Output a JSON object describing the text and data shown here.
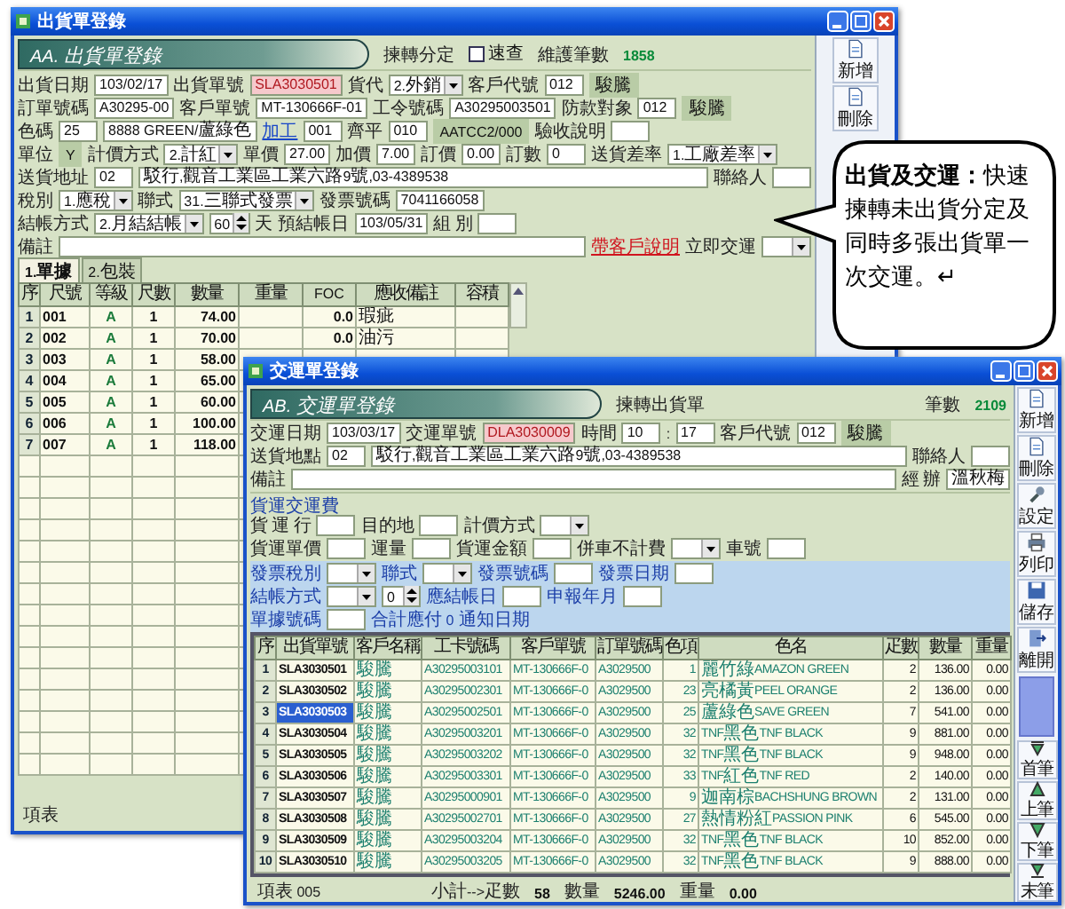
{
  "window_1": {
    "title": "出貨單登錄",
    "heading": "AA. 出貨單登錄",
    "header_text": "揀轉分定",
    "quick_check": {
      "label": "速查",
      "checked": false
    },
    "count_label": "維護筆數",
    "count": "1858",
    "toolbar": [
      {
        "label": "新增"
      },
      {
        "label": "刪除"
      }
    ],
    "form_rows": [
      [
        {
          "kind": "label",
          "text": "出貨日期"
        },
        {
          "kind": "field",
          "value": "103/02/17"
        },
        {
          "kind": "label",
          "text": "出貨單號"
        },
        {
          "kind": "key",
          "value": "SLA3030501"
        },
        {
          "kind": "label",
          "text": "貨代"
        },
        {
          "kind": "select",
          "value": "2.外銷"
        },
        {
          "kind": "label",
          "text": "客戶代號"
        },
        {
          "kind": "field",
          "value": "012"
        },
        {
          "kind": "shade",
          "text": "駿騰"
        }
      ],
      [
        {
          "kind": "label",
          "text": "訂單號碼"
        },
        {
          "kind": "field",
          "value": "A30295-00"
        },
        {
          "kind": "label",
          "text": "客戶單號"
        },
        {
          "kind": "field",
          "value": "MT-130666F-01"
        },
        {
          "kind": "label",
          "text": "工令號碼"
        },
        {
          "kind": "field",
          "value": "A30295003501"
        },
        {
          "kind": "label",
          "text": "防款對象"
        },
        {
          "kind": "field",
          "value": "012"
        },
        {
          "kind": "shade",
          "text": "駿騰"
        }
      ],
      [
        {
          "kind": "label",
          "text": "色碼"
        },
        {
          "kind": "field",
          "value": "25"
        },
        {
          "kind": "field",
          "value": "8888 GREEN/蘆綠色"
        },
        {
          "kind": "link",
          "text": "加工"
        },
        {
          "kind": "field",
          "value": "001"
        },
        {
          "kind": "label",
          "text": "齊平"
        },
        {
          "kind": "field",
          "value": "010"
        },
        {
          "kind": "shade",
          "text": "AATCC2/000"
        },
        {
          "kind": "label",
          "text": "驗收說明"
        },
        {
          "kind": "field"
        }
      ],
      [
        {
          "kind": "label",
          "text": "單位"
        },
        {
          "kind": "shade",
          "text": "Y"
        },
        {
          "kind": "label",
          "text": "計價方式"
        },
        {
          "kind": "select",
          "value": "2.計紅"
        },
        {
          "kind": "label",
          "text": "單價"
        },
        {
          "kind": "field",
          "value": "27.00"
        },
        {
          "kind": "label",
          "text": "加價"
        },
        {
          "kind": "field",
          "value": "7.00"
        },
        {
          "kind": "label",
          "text": "訂價"
        },
        {
          "kind": "field",
          "value": "0.00"
        },
        {
          "kind": "label",
          "text": "訂數"
        },
        {
          "kind": "field",
          "value": "0"
        },
        {
          "kind": "label",
          "text": "送貨差率"
        },
        {
          "kind": "select",
          "value": "1.工廠差率"
        }
      ],
      [
        {
          "kind": "label",
          "text": "送貨地址"
        },
        {
          "kind": "field",
          "value": "02"
        },
        {
          "kind": "memo",
          "value": "駁行,觀音工業區工業六路9號,03-4389538"
        },
        {
          "kind": "label",
          "text": "聯絡人"
        },
        {
          "kind": "field"
        }
      ],
      [
        {
          "kind": "label",
          "text": "稅別"
        },
        {
          "kind": "select",
          "value": "1.應稅"
        },
        {
          "kind": "label",
          "text": "聯式"
        },
        {
          "kind": "select",
          "value": "31.三聯式發票"
        },
        {
          "kind": "label",
          "text": "發票號碼"
        },
        {
          "kind": "field",
          "value": "7041166058"
        }
      ],
      [
        {
          "kind": "label",
          "text": "結帳方式"
        },
        {
          "kind": "select",
          "value": "2.月結結帳"
        },
        {
          "kind": "spin",
          "value": "60"
        },
        {
          "kind": "label",
          "text": "天"
        },
        {
          "kind": "label",
          "text": "預結帳日"
        },
        {
          "kind": "field",
          "value": "103/05/31"
        },
        {
          "kind": "label",
          "text": "組 別"
        },
        {
          "kind": "field"
        }
      ],
      [
        {
          "kind": "label",
          "text": "備註"
        },
        {
          "kind": "memo"
        },
        {
          "kind": "alert_link",
          "text": "帶客戶說明"
        },
        {
          "kind": "label",
          "text": "立即交運"
        },
        {
          "kind": "select"
        }
      ]
    ],
    "tabs": [
      {
        "label": "1.單據",
        "selected": true
      },
      {
        "label": "2.包裝",
        "selected": false
      }
    ],
    "table": {
      "columns": [
        "序",
        "尺號",
        "等級",
        "尺數",
        "數量",
        "重量",
        "FOC",
        "應收備註",
        "容積"
      ],
      "rows": [
        [
          "1",
          "001",
          "A",
          "1",
          "74.00",
          null,
          "0.0",
          "瑕疵"
        ],
        [
          "2",
          "002",
          "A",
          "1",
          "70.00",
          null,
          "0.0",
          "油污"
        ],
        [
          "3",
          "003",
          "A",
          "1",
          "58.00"
        ],
        [
          "4",
          "004",
          "A",
          "1",
          "65.00"
        ],
        [
          "5",
          "005",
          "A",
          "1",
          "60.00"
        ],
        [
          "6",
          "006",
          "A",
          "1",
          "100.00"
        ],
        [
          "7",
          "007",
          "A",
          "1",
          "118.00"
        ]
      ]
    },
    "footer_label": "項表"
  },
  "window_2": {
    "title": "交運單登錄",
    "heading": "AB. 交運單登錄",
    "header_text": "揀轉出貨單",
    "count_label": "筆數",
    "count": "2109",
    "toolbar": [
      {
        "label": "新增"
      },
      {
        "label": "刪除"
      },
      {
        "label": "設定"
      },
      {
        "label": "列印"
      },
      {
        "label": "儲存"
      },
      {
        "label": "離開"
      }
    ],
    "nav": [
      {
        "label": "首筆"
      },
      {
        "label": "上筆"
      },
      {
        "label": "下筆"
      },
      {
        "label": "末筆"
      }
    ],
    "sections": [
      {
        "kind": "main",
        "rows": [
          [
            {
              "kind": "label",
              "text": "交運日期"
            },
            {
              "kind": "field",
              "value": "103/03/17"
            },
            {
              "kind": "label",
              "text": "交運單號"
            },
            {
              "kind": "key",
              "value": "DLA3030009"
            },
            {
              "kind": "label",
              "text": "時間"
            },
            {
              "kind": "field",
              "value": "10"
            },
            {
              "kind": "label",
              "text": ":"
            },
            {
              "kind": "field",
              "value": "17"
            },
            {
              "kind": "label",
              "text": "客戶代號"
            },
            {
              "kind": "field",
              "value": "012"
            },
            {
              "kind": "shade",
              "text": "駿騰"
            }
          ],
          [
            {
              "kind": "label",
              "text": "送貨地點"
            },
            {
              "kind": "field",
              "value": "02"
            },
            {
              "kind": "memo",
              "value": "駁行,觀音工業區工業六路9號,03-4389538"
            },
            {
              "kind": "label",
              "text": "聯絡人"
            },
            {
              "kind": "field"
            }
          ],
          [
            {
              "kind": "label",
              "text": "備註"
            },
            {
              "kind": "memo"
            },
            {
              "kind": "label",
              "text": "經 辦"
            },
            {
              "kind": "field",
              "value": "溫秋梅"
            }
          ]
        ]
      },
      {
        "kind": "freight",
        "title": "貨運交運費",
        "rows": [
          [
            {
              "kind": "label",
              "text": "貨 運 行"
            },
            {
              "kind": "field"
            },
            {
              "kind": "label",
              "text": "目的地"
            },
            {
              "kind": "field"
            },
            {
              "kind": "label",
              "text": "計價方式"
            },
            {
              "kind": "select"
            }
          ],
          [
            {
              "kind": "label",
              "text": "貨運單價"
            },
            {
              "kind": "field"
            },
            {
              "kind": "label",
              "text": "運量"
            },
            {
              "kind": "field"
            },
            {
              "kind": "label",
              "text": "貨運金額"
            },
            {
              "kind": "field"
            },
            {
              "kind": "label",
              "text": "併車不計費"
            },
            {
              "kind": "select"
            },
            {
              "kind": "label",
              "text": "車號"
            },
            {
              "kind": "field"
            }
          ]
        ]
      },
      {
        "kind": "invoice",
        "rows": [
          [
            {
              "kind": "label",
              "text": "發票稅別"
            },
            {
              "kind": "select"
            },
            {
              "kind": "label",
              "text": "聯式"
            },
            {
              "kind": "select"
            },
            {
              "kind": "label",
              "text": "發票號碼"
            },
            {
              "kind": "field"
            },
            {
              "kind": "label",
              "text": "發票日期"
            },
            {
              "kind": "field"
            }
          ],
          [
            {
              "kind": "label",
              "text": "結帳方式"
            },
            {
              "kind": "select"
            },
            {
              "kind": "spin",
              "value": "0"
            },
            {
              "kind": "label",
              "text": "應結帳日"
            },
            {
              "kind": "field"
            },
            {
              "kind": "label",
              "text": "申報年月"
            },
            {
              "kind": "field"
            }
          ],
          [
            {
              "kind": "label",
              "text": "單據號碼"
            },
            {
              "kind": "field"
            },
            {
              "kind": "label",
              "text": "合計應付 0"
            },
            {
              "kind": "label",
              "text": "通知日期"
            }
          ]
        ]
      }
    ],
    "table": {
      "columns": [
        "序",
        "出貨單號",
        "客戶名稱",
        "工卡號碼",
        "客戶單號",
        "訂單號碼",
        "色項",
        "色名",
        "疋數",
        "數量",
        "重量"
      ],
      "rows": [
        {
          "selected": false,
          "cells": [
            "1",
            "SLA3030501",
            "駿騰",
            "A30295003101",
            "MT-130666F-0",
            "A3029500",
            "1",
            "麗竹綠AMAZON GREEN",
            "2",
            "136.00",
            "0.00"
          ]
        },
        {
          "selected": false,
          "cells": [
            "2",
            "SLA3030502",
            "駿騰",
            "A30295002301",
            "MT-130666F-0",
            "A3029500",
            "23",
            "亮橘黃PEEL ORANGE",
            "2",
            "136.00",
            "0.00"
          ]
        },
        {
          "selected": true,
          "cells": [
            "3",
            "SLA3030503",
            "駿騰",
            "A30295002501",
            "MT-130666F-0",
            "A3029500",
            "25",
            "蘆綠色SAVE GREEN",
            "7",
            "541.00",
            "0.00"
          ]
        },
        {
          "selected": false,
          "cells": [
            "4",
            "SLA3030504",
            "駿騰",
            "A30295003201",
            "MT-130666F-0",
            "A3029500",
            "32",
            "TNF黑色TNF BLACK",
            "9",
            "881.00",
            "0.00"
          ]
        },
        {
          "selected": false,
          "cells": [
            "5",
            "SLA3030505",
            "駿騰",
            "A30295003202",
            "MT-130666F-0",
            "A3029500",
            "32",
            "TNF黑色TNF BLACK",
            "9",
            "948.00",
            "0.00"
          ]
        },
        {
          "selected": false,
          "cells": [
            "6",
            "SLA3030506",
            "駿騰",
            "A30295003301",
            "MT-130666F-0",
            "A3029500",
            "33",
            "TNF紅色TNF RED",
            "2",
            "140.00",
            "0.00"
          ]
        },
        {
          "selected": false,
          "cells": [
            "7",
            "SLA3030507",
            "駿騰",
            "A30295000901",
            "MT-130666F-0",
            "A3029500",
            "9",
            "迦南棕BACHSHUNG BROWN",
            "2",
            "131.00",
            "0.00"
          ]
        },
        {
          "selected": false,
          "cells": [
            "8",
            "SLA3030508",
            "駿騰",
            "A30295002701",
            "MT-130666F-0",
            "A3029500",
            "27",
            "熱情粉紅PASSION PINK",
            "6",
            "545.00",
            "0.00"
          ]
        },
        {
          "selected": false,
          "cells": [
            "9",
            "SLA3030509",
            "駿騰",
            "A30295003204",
            "MT-130666F-0",
            "A3029500",
            "32",
            "TNF黑色TNF BLACK",
            "10",
            "852.00",
            "0.00"
          ]
        },
        {
          "selected": false,
          "cells": [
            "10",
            "SLA3030510",
            "駿騰",
            "A30295003205",
            "MT-130666F-0",
            "A3029500",
            "32",
            "TNF黑色TNF BLACK",
            "9",
            "888.00",
            "0.00"
          ]
        }
      ]
    },
    "footer": {
      "items_label": "項表 005",
      "subtotal_label": "小計-->疋數",
      "pieces": "58",
      "quantity_label": "數量",
      "quantity": "5246.00",
      "weight_label": "重量",
      "weight": "0.00"
    }
  },
  "callout": {
    "text": "**出貨及交運：**快速揀轉未出貨分定及同時多張出貨單一次交運。↵"
  }
}
